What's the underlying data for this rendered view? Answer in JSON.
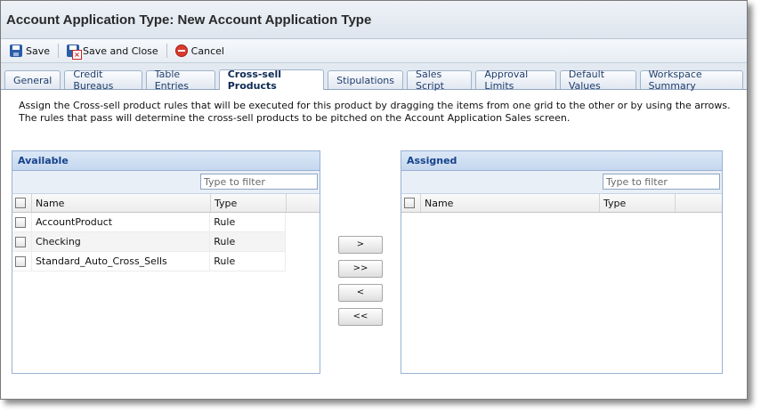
{
  "window": {
    "title": "Account Application Type: New Account Application Type"
  },
  "toolbar": {
    "save_label": "Save",
    "save_close_label": "Save and Close",
    "cancel_label": "Cancel"
  },
  "tabs": [
    {
      "label": "General",
      "active": false
    },
    {
      "label": "Credit Bureaus",
      "active": false
    },
    {
      "label": "Table Entries",
      "active": false
    },
    {
      "label": "Cross-sell Products",
      "active": true
    },
    {
      "label": "Stipulations",
      "active": false
    },
    {
      "label": "Sales Script",
      "active": false
    },
    {
      "label": "Approval Limits",
      "active": false
    },
    {
      "label": "Default Values",
      "active": false
    },
    {
      "label": "Workspace Summary",
      "active": false
    }
  ],
  "description": "Assign the Cross-sell product rules that will be executed for this product by dragging the items from one grid to the other or by using the arrows. The rules that pass will determine the cross-sell products to be pitched on the Account Application Sales screen.",
  "available": {
    "title": "Available",
    "filter_placeholder": "Type to filter",
    "columns": {
      "name": "Name",
      "type": "Type"
    },
    "rows": [
      {
        "name": "AccountProduct",
        "type": "Rule"
      },
      {
        "name": "Checking",
        "type": "Rule"
      },
      {
        "name": "Standard_Auto_Cross_Sells",
        "type": "Rule"
      }
    ]
  },
  "assigned": {
    "title": "Assigned",
    "filter_placeholder": "Type to filter",
    "columns": {
      "name": "Name",
      "type": "Type"
    },
    "rows": []
  },
  "move_buttons": {
    "add_one": ">",
    "add_all": ">>",
    "remove_one": "<",
    "remove_all": "<<"
  },
  "colors": {
    "header_text": "#15428b",
    "panel_header": "#c6d8ef",
    "active_tab_text": "#0d2a55"
  }
}
